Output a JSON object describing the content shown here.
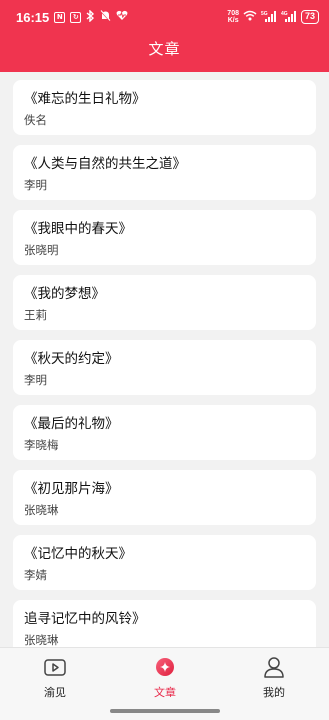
{
  "status_bar": {
    "time": "16:15",
    "net_speed_value": "708",
    "net_speed_unit": "K/s",
    "battery": "73",
    "signal_1": "5G",
    "signal_2": "4G"
  },
  "header": {
    "title": "文章"
  },
  "articles": [
    {
      "title": "《难忘的生日礼物》",
      "author": "佚名"
    },
    {
      "title": "《人类与自然的共生之道》",
      "author": "李明"
    },
    {
      "title": "《我眼中的春天》",
      "author": "张晓明"
    },
    {
      "title": "《我的梦想》",
      "author": "王莉"
    },
    {
      "title": "《秋天的约定》",
      "author": "李明"
    },
    {
      "title": "《最后的礼物》",
      "author": "李晓梅"
    },
    {
      "title": "《初见那片海》",
      "author": "张晓琳"
    },
    {
      "title": "《记忆中的秋天》",
      "author": "李婧"
    },
    {
      "title": "追寻记忆中的风铃》",
      "author": "张晓琳"
    }
  ],
  "bottom_nav": [
    {
      "label": "渝见",
      "icon": "video-icon",
      "active": false
    },
    {
      "label": "文章",
      "icon": "sparkle-icon",
      "active": true
    },
    {
      "label": "我的",
      "icon": "person-icon",
      "active": false
    }
  ],
  "colors": {
    "accent": "#f0344f",
    "active_nav": "#e8294a",
    "background": "#f2f2f2"
  }
}
